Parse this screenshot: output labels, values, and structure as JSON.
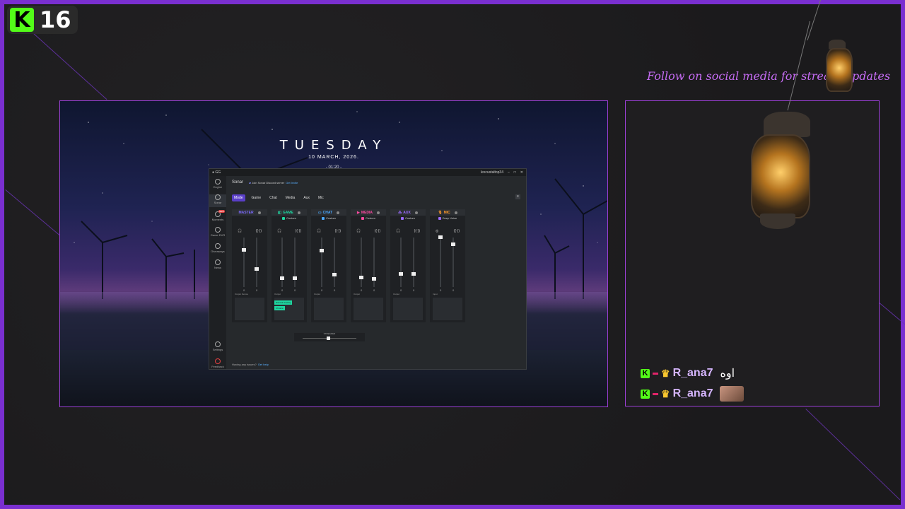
{
  "kick_badge": {
    "logo_letter": "K",
    "count": "16"
  },
  "desktop": {
    "title": "TUESDAY",
    "date": "10 MARCH, 2026.",
    "time": "- 01:20 -"
  },
  "sonar": {
    "window_user": "lexcustaltop34",
    "header": "Sonar",
    "notice": "Join Sonar Discord server",
    "notice_link": "Get Invite",
    "sidebar": [
      {
        "label": "Engine"
      },
      {
        "label": "Sonar",
        "active": true
      },
      {
        "label": "Moments",
        "badge": "NEW"
      },
      {
        "label": "Game DVR"
      },
      {
        "label": "Giveaways"
      },
      {
        "label": "News"
      },
      {
        "label": "Settings"
      },
      {
        "label": "Feedback"
      }
    ],
    "tabs": [
      "Mode",
      "Game",
      "Chat",
      "Media",
      "Aux",
      "Mic"
    ],
    "channels": [
      {
        "name": "MASTER",
        "color": "#7d6bff",
        "preset": "",
        "label": "Output Device",
        "values": [
          "0",
          "0"
        ]
      },
      {
        "name": "GAME",
        "color": "#1fd6a0",
        "preset": "Custom",
        "label": "Output",
        "values": [
          "0",
          "0"
        ]
      },
      {
        "name": "CHAT",
        "color": "#4aa8ff",
        "preset": "Custom",
        "label": "Output",
        "values": [
          "0",
          "0"
        ]
      },
      {
        "name": "MEDIA",
        "color": "#ff4aa0",
        "preset": "Custom",
        "label": "Output",
        "values": [
          "0",
          "0"
        ]
      },
      {
        "name": "AUX",
        "color": "#9a6bff",
        "preset": "Custom",
        "label": "Output",
        "values": [
          "0",
          "0"
        ]
      },
      {
        "name": "MIC",
        "color": "#ff9b2a",
        "preset": "Deep Voice",
        "label": "Input",
        "values": [
          "0",
          "0"
        ]
      }
    ],
    "game_devices": [
      "Discord Overlay",
      "Chrome"
    ],
    "streamer_label": "STREAMER",
    "footer": "Having any issues?",
    "footer_link": "Get help"
  },
  "follow_text": "Follow on social media for stream updates",
  "chat": [
    {
      "user": "R_ana7",
      "message": "اوه"
    },
    {
      "user": "R_ana7",
      "message": ""
    }
  ],
  "colors": {
    "frame": "#7a2fd0",
    "accent": "#9b3fd6",
    "kick": "#53fc18"
  }
}
